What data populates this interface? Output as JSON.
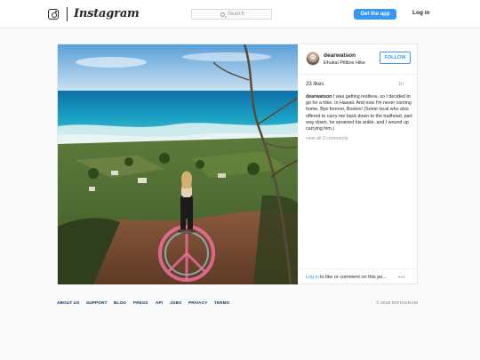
{
  "header": {
    "logo_text": "Instagram",
    "search_placeholder": "Search",
    "get_app_label": "Get the app",
    "login_label": "Log in"
  },
  "post": {
    "username": "dearwatson",
    "location": "Ehukai Pillbox Hike",
    "follow_label": "FOLLOW",
    "likes": "23 likes",
    "age": "1h",
    "caption_user": "dearwatson",
    "caption_text": " I was getting restless, so I decided to go for a hike. In Hawaii. And now I'm never coming home. Bye forever, Boston! (Some local who also offered to carry me back down to the trailhead, part way down, he sprained his ankle, and I wound up carrying him.)",
    "view_comments": "view all 3 comments",
    "footer_login": "Log in",
    "footer_rest": "to like or comment on this po...",
    "more_icon": "ellipsis-icon"
  },
  "footer": {
    "links": [
      "ABOUT US",
      "SUPPORT",
      "BLOG",
      "PRESS",
      "API",
      "JOBS",
      "PRIVACY",
      "TERMS"
    ],
    "copyright": "© 2018 INSTAGRAM"
  },
  "colors": {
    "accent": "#3897f0",
    "link_dark": "#003569",
    "muted": "#999999"
  }
}
